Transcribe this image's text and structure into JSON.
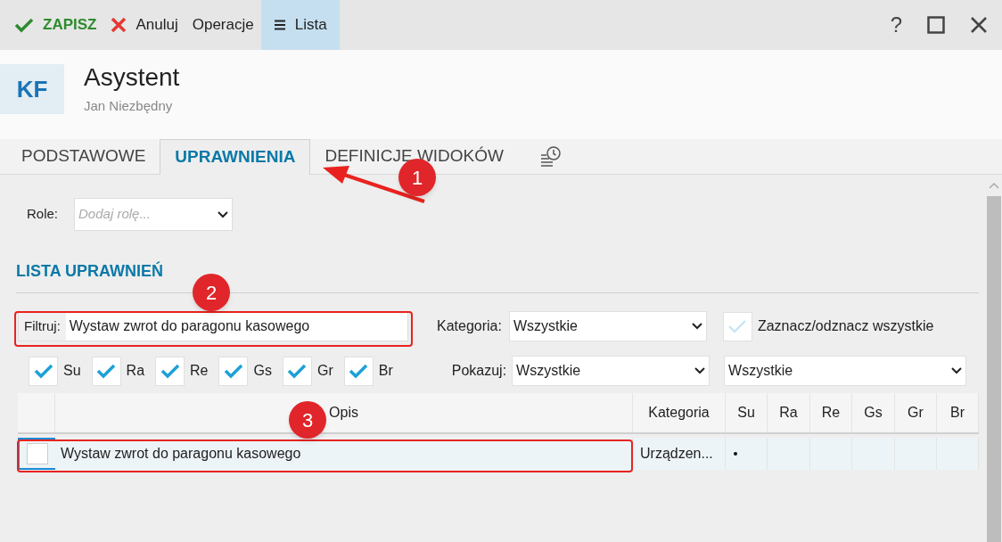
{
  "toolbar": {
    "buttons": [
      {
        "kind": "save",
        "label": "ZAPISZ",
        "selected": false
      },
      {
        "kind": "cancel",
        "label": "Anuluj",
        "selected": false
      },
      {
        "kind": "plain",
        "label": "Operacje",
        "selected": false
      },
      {
        "kind": "menu",
        "label": "Lista",
        "selected": true
      }
    ],
    "help": "?"
  },
  "header": {
    "initials": "KF",
    "title": "Asystent",
    "subtitle": "Jan Niezbędny"
  },
  "tabs": [
    {
      "label": "PODSTAWOWE",
      "selected": false
    },
    {
      "label": "UPRAWNIENIA",
      "selected": true
    },
    {
      "label": "DEFINICJE WIDOKÓW",
      "selected": false
    }
  ],
  "roles": {
    "label": "Role:",
    "placeholder": "Dodaj rolę..."
  },
  "section_title": "LISTA UPRAWNIEŃ",
  "filter": {
    "label": "Filtruj:",
    "value": "Wystaw zwrot do paragonu kasowego"
  },
  "category": {
    "label": "Kategoria:",
    "value": "Wszystkie"
  },
  "select_all": {
    "label": "Zaznacz/odznacz wszystkie",
    "checked": false
  },
  "role_checks": [
    {
      "label": "Su",
      "checked": true
    },
    {
      "label": "Ra",
      "checked": true
    },
    {
      "label": "Re",
      "checked": true
    },
    {
      "label": "Gs",
      "checked": true
    },
    {
      "label": "Gr",
      "checked": true
    },
    {
      "label": "Br",
      "checked": true
    }
  ],
  "show": {
    "label": "Pokazuj:",
    "value": "Wszystkie",
    "value_2": "Wszystkie"
  },
  "table": {
    "columns": [
      "Opis",
      "Kategoria",
      "Su",
      "Ra",
      "Re",
      "Gs",
      "Gr",
      "Br"
    ],
    "rows": [
      {
        "checked": false,
        "selected": true,
        "description": "Wystaw zwrot do paragonu kasowego",
        "category": "Urządzen...",
        "flags": [
          true,
          false,
          false,
          false,
          false,
          false
        ]
      }
    ]
  },
  "annotations": [
    {
      "label": "1"
    },
    {
      "label": "2"
    },
    {
      "label": "3"
    }
  ]
}
